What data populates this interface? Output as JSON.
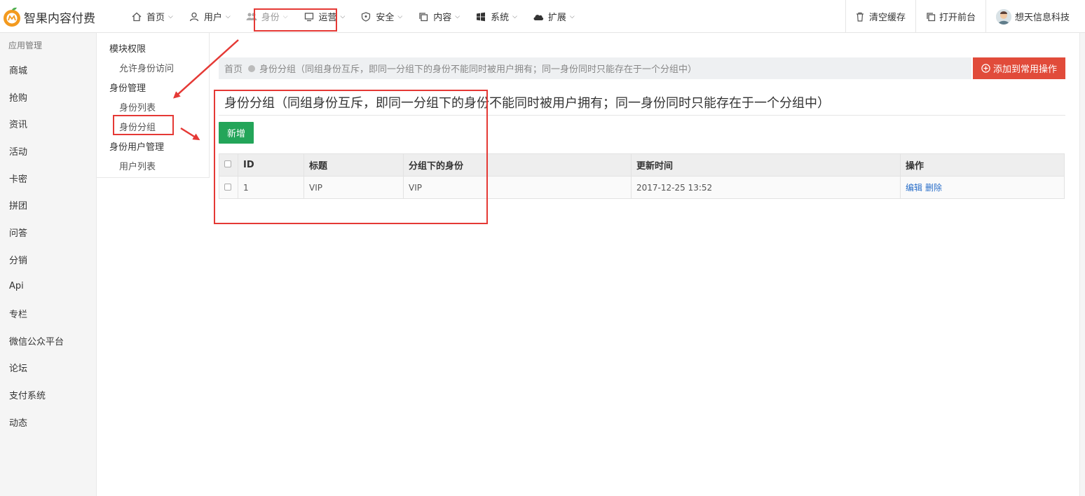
{
  "app": {
    "name": "智果内容付费"
  },
  "nav": [
    {
      "label": "首页",
      "icon": "home-icon",
      "active": false
    },
    {
      "label": "用户",
      "icon": "user-icon",
      "active": false
    },
    {
      "label": "身份",
      "icon": "users-icon",
      "active": true
    },
    {
      "label": "运营",
      "icon": "monitor-icon",
      "active": false
    },
    {
      "label": "安全",
      "icon": "shield-icon",
      "active": false
    },
    {
      "label": "内容",
      "icon": "copy-icon",
      "active": false
    },
    {
      "label": "系统",
      "icon": "windows-icon",
      "active": false
    },
    {
      "label": "扩展",
      "icon": "cloud-icon",
      "active": false
    }
  ],
  "tools": {
    "clear_cache": "清空缓存",
    "open_front": "打开前台",
    "user_name": "想天信息科技"
  },
  "left_menu": {
    "title": "应用管理",
    "items": [
      "商城",
      "抢购",
      "资讯",
      "活动",
      "卡密",
      "拼团",
      "问答",
      "分销",
      "Api",
      "专栏",
      "微信公众平台",
      "论坛",
      "支付系统",
      "动态"
    ]
  },
  "sub_menu": {
    "groups": [
      {
        "label": "模块权限",
        "items": [
          "允许身份访问"
        ]
      },
      {
        "label": "身份管理",
        "items": [
          "身份列表",
          "身份分组"
        ]
      },
      {
        "label": "身份用户管理",
        "items": [
          "用户列表"
        ]
      }
    ]
  },
  "breadcrumb": {
    "home": "首页",
    "current": "身份分组（同组身份互斥，即同一分组下的身份不能同时被用户拥有；同一身份同时只能存在于一个分组中）"
  },
  "add_common_label": "添加到常用操作",
  "page_title": "身份分组（同组身份互斥，即同一分组下的身份不能同时被用户拥有；同一身份同时只能存在于一个分组中）",
  "new_label": "新增",
  "table": {
    "headers": [
      "ID",
      "标题",
      "分组下的身份",
      "更新时间",
      "操作"
    ],
    "rows": [
      {
        "id": "1",
        "title": "VIP",
        "identities": "VIP",
        "updated": "2017-12-25 13:52",
        "edit": "编辑",
        "delete": "删除"
      }
    ]
  },
  "colors": {
    "accent_red": "#e14b3a",
    "green": "#23a559",
    "link": "#2a6fc9",
    "annotation": "#e53935"
  }
}
